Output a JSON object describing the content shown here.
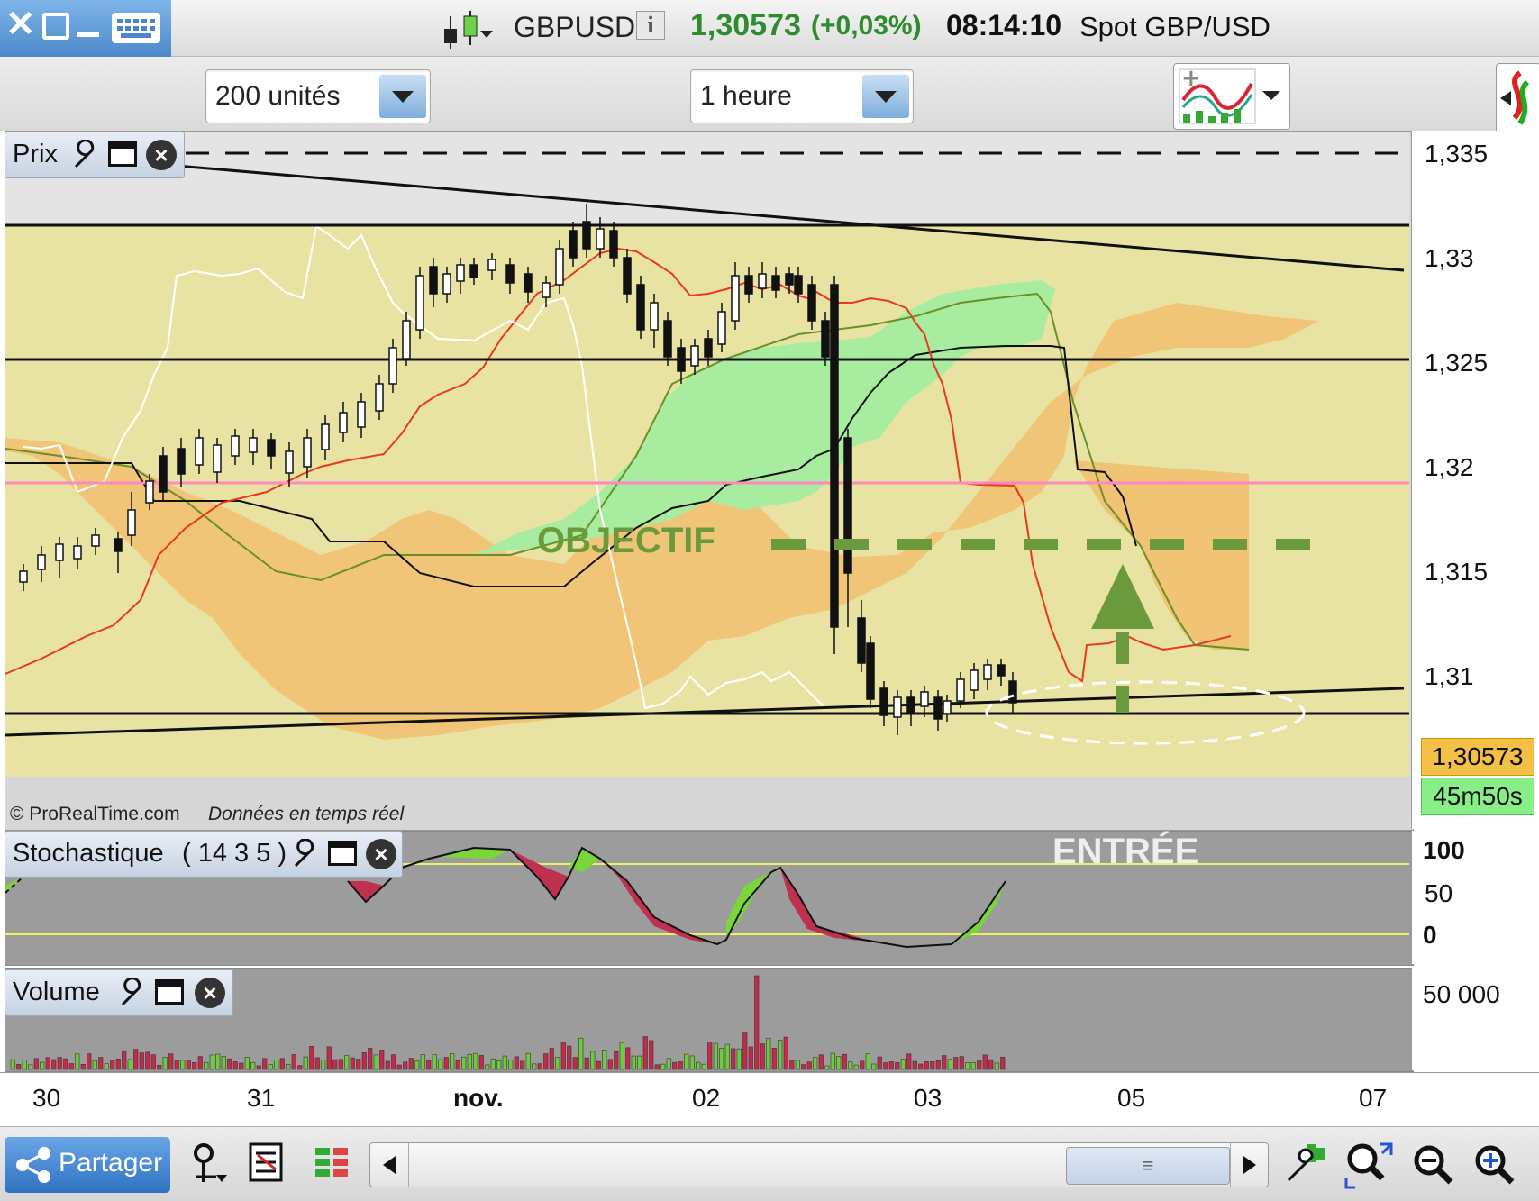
{
  "titlebar": {
    "symbol": "GBPUSD",
    "price": "1,30573",
    "change": "(+0,03%)",
    "time": "08:14:10",
    "description": "Spot GBP/USD",
    "info_icon": "i"
  },
  "toolbar": {
    "units_select": "200 unités",
    "interval_select": "1 heure"
  },
  "price_panel": {
    "title": "Prix",
    "y_ticks": [
      "1,335",
      "1,33",
      "1,325",
      "1,32",
      "1,315",
      "1,31"
    ],
    "current_price": "1,30573",
    "countdown": "45m50s",
    "copyright": "© ProRealTime.com",
    "realtime_note": "Données en temps réel",
    "annotation_objectif": "OBJECTIF",
    "annotation_entree": "ENTRÉE"
  },
  "stoch_panel": {
    "title": "Stochastique",
    "params": "( 14 3 5 )",
    "y_ticks": [
      "100",
      "50",
      "0"
    ]
  },
  "volume_panel": {
    "title": "Volume",
    "y_tick": "50 000"
  },
  "x_axis": {
    "labels": [
      "30",
      "31",
      "nov.",
      "02",
      "03",
      "05",
      "07"
    ]
  },
  "bottombar": {
    "share_label": "Partager"
  },
  "colors": {
    "price_up": "#2e8b2e",
    "panel_bg": "#e8e3a3",
    "cloud_bull": "#a8eca0",
    "cloud_bear": "#f2c070",
    "objective_line": "#ff88c0",
    "annotation_green": "#6b9a3c"
  },
  "icons": [
    "close-icon",
    "maximize-icon",
    "minimize-icon",
    "keyboard-icon",
    "candlestick-icon",
    "info-icon",
    "indicator-icon",
    "wrench-icon",
    "share-icon",
    "drawing-icon",
    "list-icon",
    "grid-icon",
    "scroll-left-icon",
    "scroll-right-icon",
    "zoom-fit-icon",
    "zoom-out-icon",
    "zoom-in-icon"
  ]
}
